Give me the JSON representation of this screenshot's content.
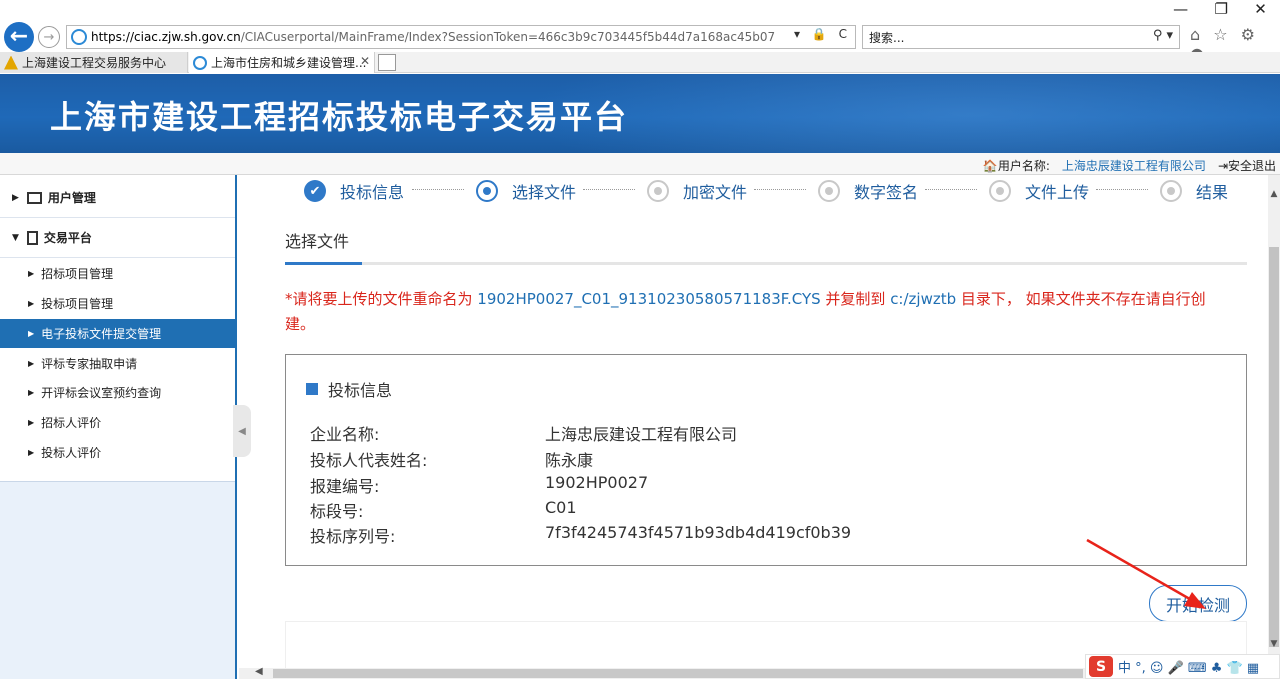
{
  "browser": {
    "url_domain": "https://ciac.zjw.sh.gov.cn",
    "url_rest": "/CIACuserportal/MainFrame/Index?SessionToken=466c3b9c703445f5b44d7a168ac45b07",
    "url_tools": "▾ 🔒 C",
    "search_placeholder": "搜索...",
    "search_icon_text": "⚲ ▾",
    "right_icons": "⌂ ☆ ⚙ ●",
    "window_controls": [
      "—",
      "❐",
      "✕"
    ],
    "back_glyph": "←",
    "forward_glyph": "→",
    "tabs": [
      {
        "label": "上海建设工程交易服务中心"
      },
      {
        "label": "上海市住房和城乡建设管理...",
        "close": "✕"
      }
    ]
  },
  "banner": {
    "title": "上海市建设工程招标投标电子交易平台"
  },
  "user_bar": {
    "user_label": "🏠用户名称:",
    "company": "上海忠辰建设工程有限公司",
    "logout": "⇥安全退出"
  },
  "sidebar": {
    "groups": [
      {
        "label": "用户管理"
      },
      {
        "label": "交易平台"
      }
    ],
    "items": [
      {
        "label": "招标项目管理"
      },
      {
        "label": "投标项目管理"
      },
      {
        "label": "电子投标文件提交管理"
      },
      {
        "label": "评标专家抽取申请"
      },
      {
        "label": "开评标会议室预约查询"
      },
      {
        "label": "招标人评价"
      },
      {
        "label": "投标人评价"
      }
    ],
    "arrow_collapsed": "▶",
    "arrow_expanded": "▼",
    "toggle_glyph": "◀"
  },
  "steps": [
    {
      "label": "投标信息",
      "state": "done",
      "glyph": "✔"
    },
    {
      "label": "选择文件",
      "state": "current"
    },
    {
      "label": "加密文件",
      "state": "pending"
    },
    {
      "label": "数字签名",
      "state": "pending"
    },
    {
      "label": "文件上传",
      "state": "pending"
    },
    {
      "label": "结果",
      "state": "pending"
    }
  ],
  "content": {
    "section_title": "选择文件",
    "notice_prefix": "*请将要上传的文件重命名为 ",
    "notice_filename": "1902HP0027_C01_91310230580571183F.CYS",
    "notice_middle": " 并复制到 ",
    "notice_dir": "c:/zjwztb",
    "notice_suffix": " 目录下， 如果文件夹不存在请自行创建。",
    "info_title": "投标信息",
    "info_rows": [
      {
        "label": "企业名称:",
        "value": "上海忠辰建设工程有限公司"
      },
      {
        "label": "投标人代表姓名:",
        "value": "陈永康"
      },
      {
        "label": "报建编号:",
        "value": "1902HP0027"
      },
      {
        "label": "标段号:",
        "value": "C01"
      },
      {
        "label": "投标序列号:",
        "value": "7f3f4245743f4571b93db4d419cf0b39"
      }
    ],
    "check_button": "开始检测"
  },
  "scroll": {
    "up": "▲",
    "down": "▼",
    "left": "◀"
  },
  "ime": {
    "logo": "S",
    "items": "中 °, ☺ 🎤 ⌨ ♣ 👕 ▦"
  },
  "colors": {
    "accent": "#2f79c8",
    "notice_red": "#d9261c",
    "banner_blue": "#1f69b8"
  }
}
